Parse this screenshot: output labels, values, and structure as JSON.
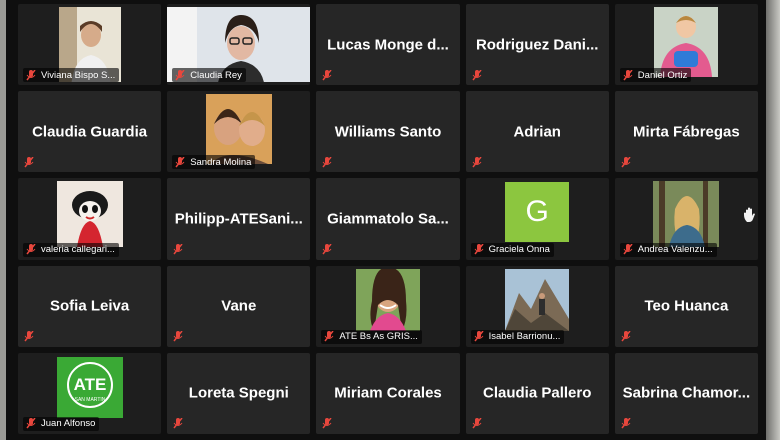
{
  "participants": [
    {
      "name": "Viviana Bispo S...",
      "label": "Viviana Bispo S...",
      "muted": true,
      "video": true
    },
    {
      "name": "Claudia Rey",
      "label": "Claudia Rey",
      "muted": true,
      "video": true
    },
    {
      "name": "Lucas Monge d...",
      "muted": true,
      "video": false
    },
    {
      "name": "Rodriguez Dani...",
      "muted": true,
      "video": false
    },
    {
      "name": "Daniel Ortiz",
      "label": "Daniel Ortiz",
      "muted": true,
      "video": true
    },
    {
      "name": "Claudia Guardia",
      "muted": true,
      "video": false
    },
    {
      "name": "Sandra Molina",
      "label": "Sandra Molina",
      "muted": true,
      "video": true
    },
    {
      "name": "Williams Santo",
      "muted": true,
      "video": false
    },
    {
      "name": "Adrian",
      "muted": true,
      "video": false
    },
    {
      "name": "Mirta Fábregas",
      "muted": true,
      "video": false
    },
    {
      "name": "valeria callegari...",
      "label": "valeria callegari...",
      "muted": true,
      "video": true
    },
    {
      "name": "Philipp-ATESani...",
      "muted": true,
      "video": false
    },
    {
      "name": "Giammatolo Sa...",
      "muted": true,
      "video": false
    },
    {
      "name": "Graciela Onna",
      "label": "Graciela Onna",
      "avatar_letter": "G",
      "muted": true,
      "video": true
    },
    {
      "name": "Andrea Valenzu...",
      "label": "Andrea Valenzu...",
      "muted": true,
      "video": true
    },
    {
      "name": "Sofia Leiva",
      "muted": true,
      "video": false
    },
    {
      "name": "Vane",
      "muted": true,
      "video": false
    },
    {
      "name": "ATE Bs As GRIS...",
      "label": "ATE Bs As GRIS...",
      "muted": true,
      "video": true
    },
    {
      "name": "Isabel Barrionu...",
      "label": "Isabel Barrionu...",
      "muted": true,
      "video": true
    },
    {
      "name": "Teo Huanca",
      "muted": true,
      "video": false
    },
    {
      "name": "Juan Alfonso",
      "label": "Juan Alfonso",
      "logo_text": "ATE",
      "logo_subtext": "SAN MARTIN",
      "muted": true,
      "video": true
    },
    {
      "name": "Loreta Spegni",
      "muted": true,
      "video": false
    },
    {
      "name": "Miriam Corales",
      "muted": true,
      "video": false
    },
    {
      "name": "Claudia Pallero",
      "muted": true,
      "video": false
    },
    {
      "name": "Sabrina Chamor...",
      "muted": true,
      "video": false
    }
  ],
  "colors": {
    "muted_icon": "#e8473d",
    "avatar_green": "#8cc63f",
    "ate_green": "#3aa935",
    "tile_bg": "#262626"
  },
  "icons": {
    "muted": "mic-off-icon",
    "raise_hand": "raised-hand-icon"
  }
}
